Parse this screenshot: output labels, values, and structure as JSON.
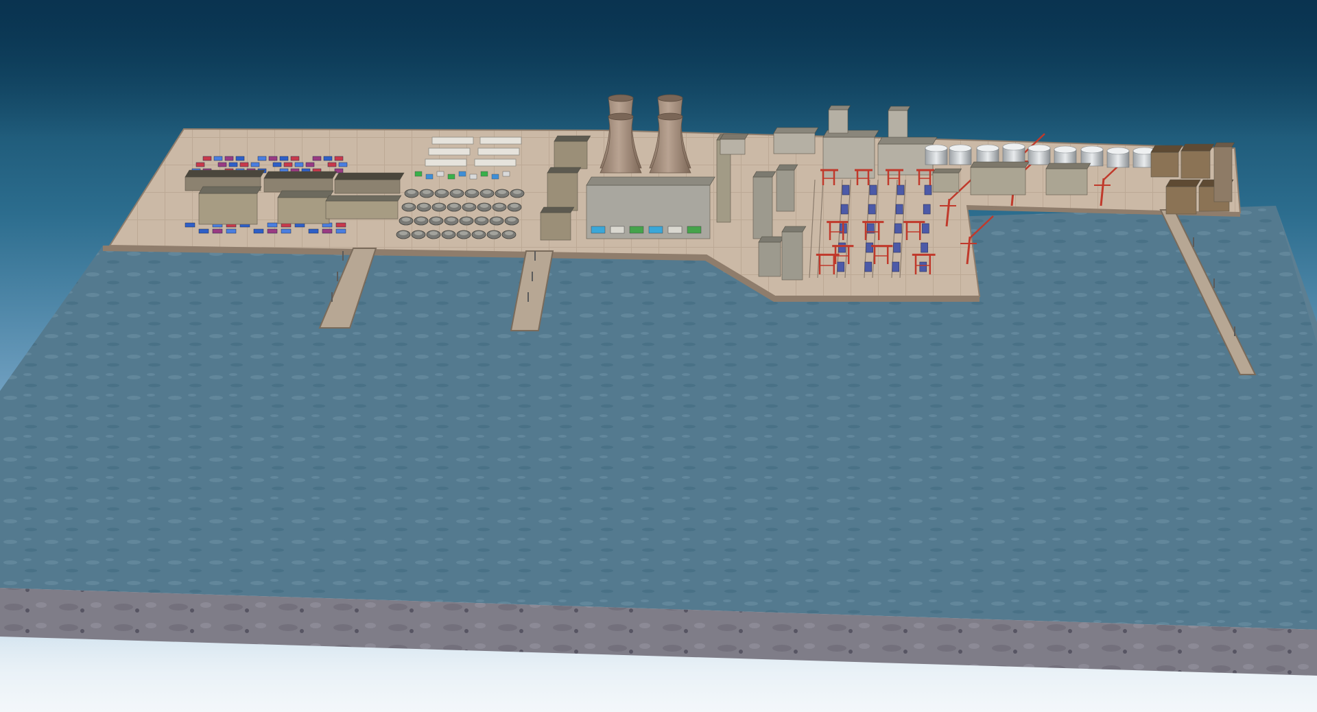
{
  "scene": {
    "description_type": "3d-harbor-industrial-model",
    "colors": {
      "sky_top": "#0b3f5a",
      "sky_bottom": "#e2edf4",
      "water": "#4f7489",
      "water_light": "#6b8ea2",
      "quay": "#c9b8a6",
      "quay_edge": "#8f7d6c",
      "base_side": "#7d7b85",
      "building_roof": "#6d6a5e",
      "building_wall": "#a79c83",
      "container_blue": "#2e5fc7",
      "container_red": "#c8394b",
      "crane_red": "#c0392b",
      "cooling_tower": "#a9927f",
      "tank_silver": "#cfd3d6"
    },
    "zones": [
      {
        "name": "container-yard",
        "icon": "container-icon"
      },
      {
        "name": "storage-hall-area",
        "icon": "warehouse-icon"
      },
      {
        "name": "tank-farm-west",
        "icon": "tank-icon"
      },
      {
        "name": "power-plant",
        "icon": "cooling-tower-icon"
      },
      {
        "name": "crane-berth",
        "icon": "crane-icon"
      },
      {
        "name": "tank-farm-east",
        "icon": "tank-icon"
      },
      {
        "name": "east-warehouses",
        "icon": "warehouse-icon"
      }
    ]
  }
}
